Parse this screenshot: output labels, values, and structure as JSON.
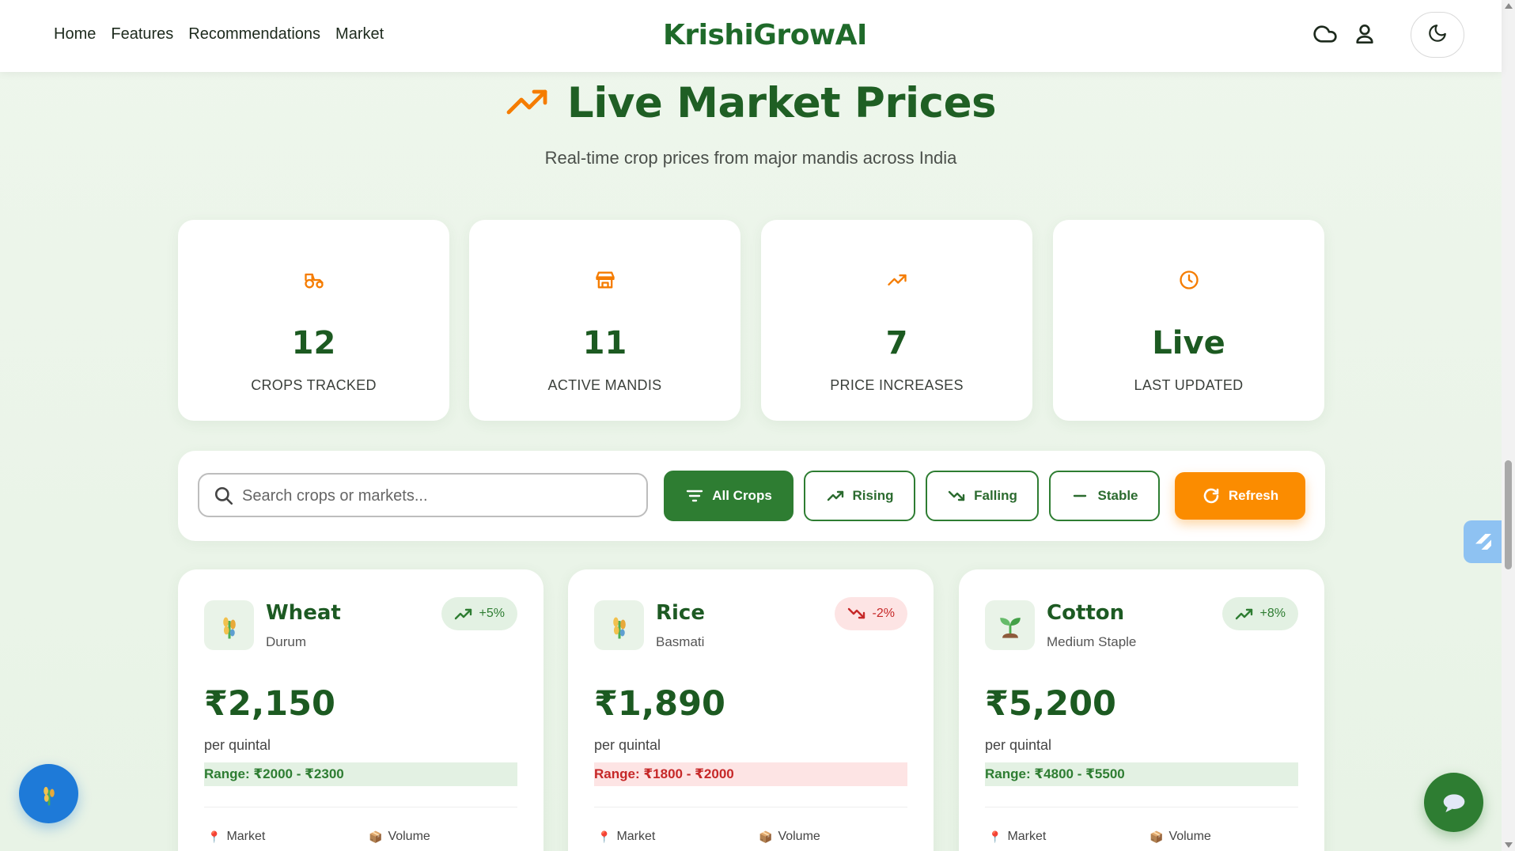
{
  "nav": {
    "links": [
      "Home",
      "Features",
      "Recommendations",
      "Market"
    ],
    "brand": "KrishiGrowAI",
    "icons": [
      "cloud-icon",
      "user-icon",
      "moon-icon"
    ]
  },
  "hero": {
    "title": "Live Market Prices",
    "subtitle": "Real-time crop prices from major mandis across India"
  },
  "stats": [
    {
      "icon": "tractor-icon",
      "value": "12",
      "label": "CROPS TRACKED"
    },
    {
      "icon": "store-icon",
      "value": "11",
      "label": "ACTIVE MANDIS"
    },
    {
      "icon": "trending-up-icon",
      "value": "7",
      "label": "PRICE INCREASES"
    },
    {
      "icon": "clock-icon",
      "value": "Live",
      "label": "LAST UPDATED"
    }
  ],
  "filters": {
    "search_placeholder": "Search crops or markets...",
    "all": "All Crops",
    "rising": "Rising",
    "falling": "Falling",
    "stable": "Stable",
    "refresh": "Refresh"
  },
  "crops": [
    {
      "name": "Wheat",
      "variety": "Durum",
      "change": "+5%",
      "trend": "up",
      "price": "₹2,150",
      "unit": "per quintal",
      "range": "Range: ₹2000 - ₹2300",
      "market_label": "Market",
      "volume_label": "Volume"
    },
    {
      "name": "Rice",
      "variety": "Basmati",
      "change": "-2%",
      "trend": "down",
      "price": "₹1,890",
      "unit": "per quintal",
      "range": "Range: ₹1800 - ₹2000",
      "market_label": "Market",
      "volume_label": "Volume"
    },
    {
      "name": "Cotton",
      "variety": "Medium Staple",
      "change": "+8%",
      "trend": "up",
      "price": "₹5,200",
      "unit": "per quintal",
      "range": "Range: ₹4800 - ₹5500",
      "market_label": "Market",
      "volume_label": "Volume"
    }
  ],
  "colors": {
    "brand_green": "#1f6a2a",
    "accent_orange": "#fb8c00",
    "up_green": "#2e7d32",
    "down_red": "#c62828"
  }
}
